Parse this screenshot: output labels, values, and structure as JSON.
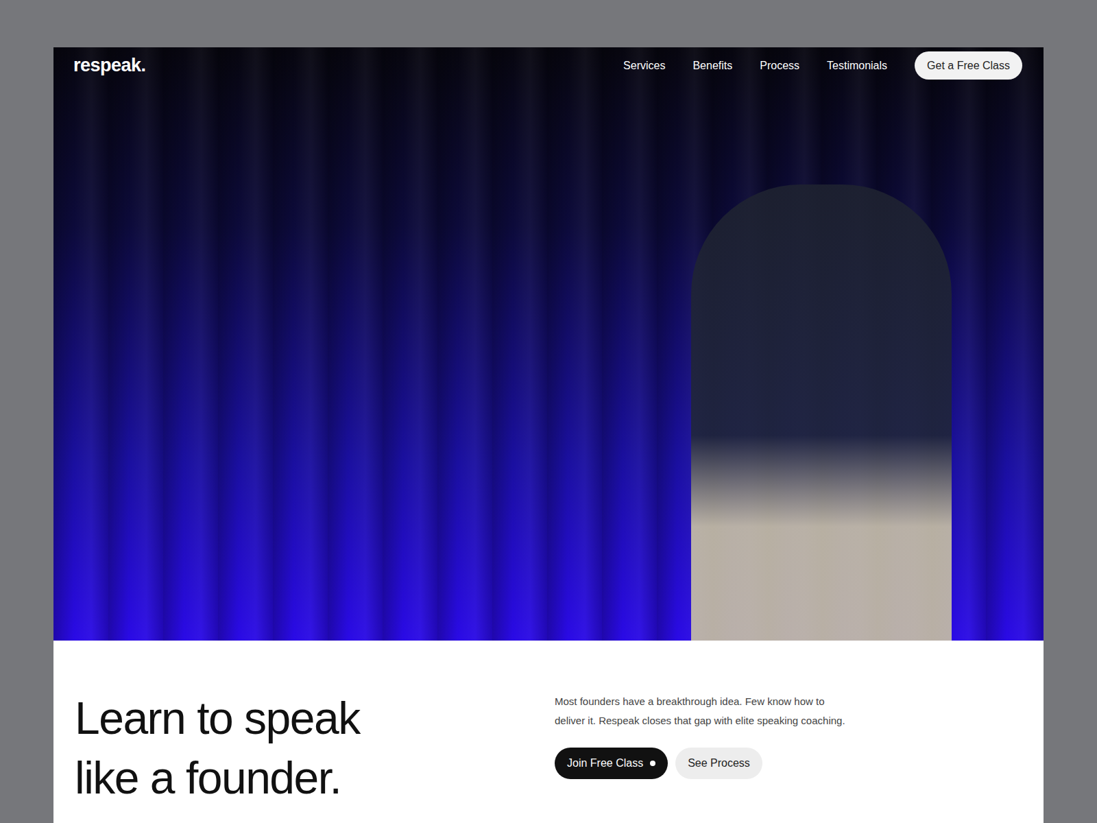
{
  "nav": {
    "logo": "respeak.",
    "links": [
      {
        "label": "Services"
      },
      {
        "label": "Benefits"
      },
      {
        "label": "Process"
      },
      {
        "label": "Testimonials"
      }
    ],
    "cta": "Get a Free Class"
  },
  "hero": {
    "heading_lines": [
      "Learn to speak",
      "like a founder."
    ],
    "description_lines": [
      "Most founders have a breakthrough idea. Few know how to",
      "deliver it. Respeak closes that gap with elite speaking coaching."
    ],
    "buttons": [
      {
        "label": "Join Free Class",
        "kind": "primary"
      },
      {
        "label": "See Process",
        "kind": "secondary"
      }
    ]
  }
}
